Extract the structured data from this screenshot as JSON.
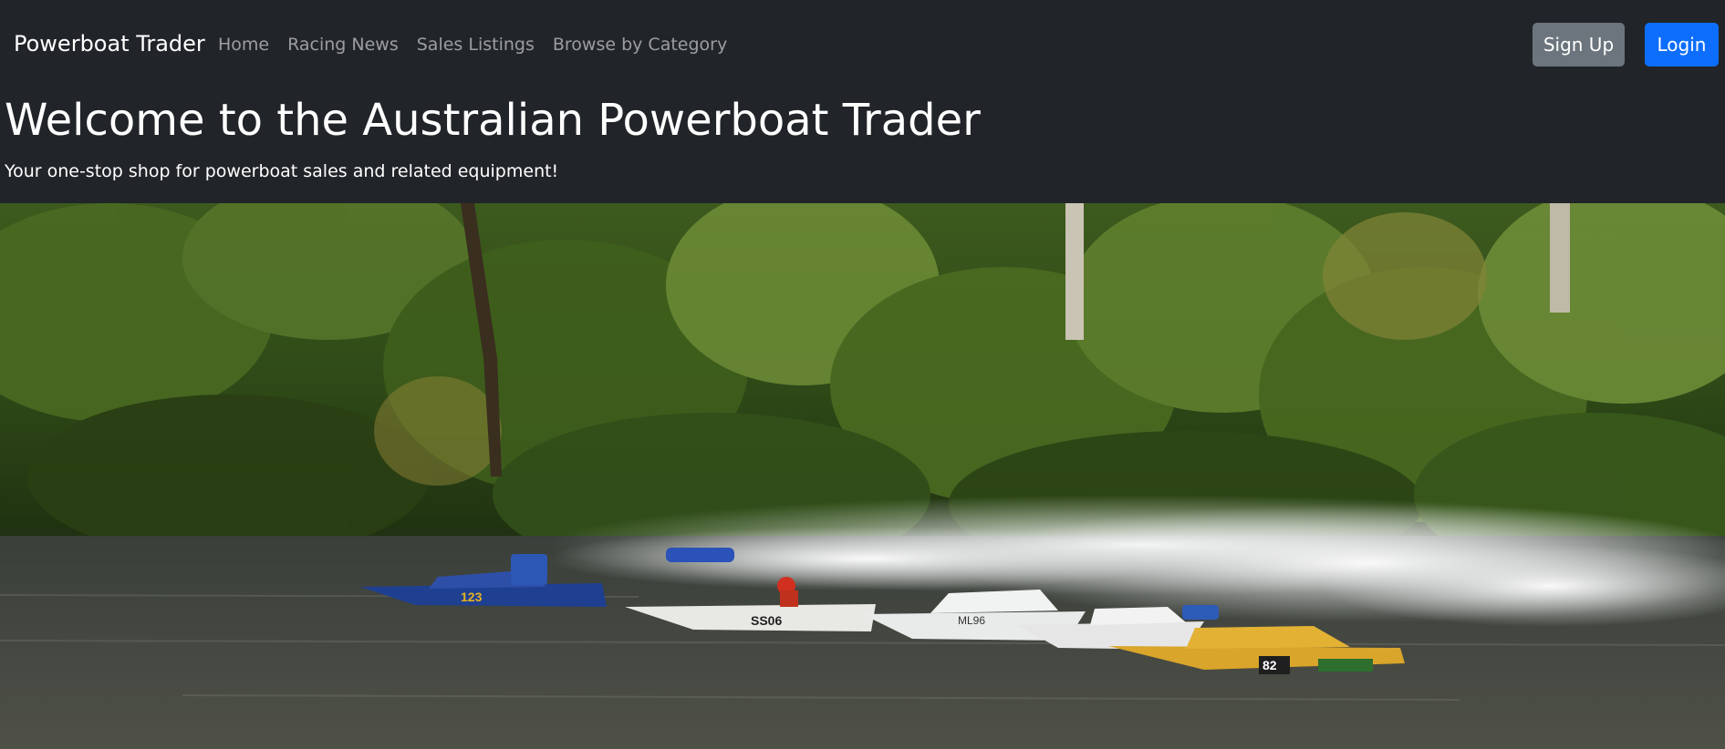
{
  "navbar": {
    "brand": "Powerboat Trader",
    "links": [
      {
        "label": "Home"
      },
      {
        "label": "Racing News"
      },
      {
        "label": "Sales Listings"
      },
      {
        "label": "Browse by Category"
      }
    ],
    "signup_label": "Sign Up",
    "login_label": "Login"
  },
  "hero": {
    "title": "Welcome to the Australian Powerboat Trader",
    "subtitle": "Your one-stop shop for powerboat sales and related equipment!"
  },
  "photo": {
    "boats": [
      {
        "number": "123"
      },
      {
        "number": "SS06"
      },
      {
        "number": "ML96"
      },
      {
        "number": "82"
      }
    ]
  },
  "colors": {
    "navbar_bg": "#212529",
    "signup_bg": "#6c757d",
    "login_bg": "#0d6efd"
  }
}
